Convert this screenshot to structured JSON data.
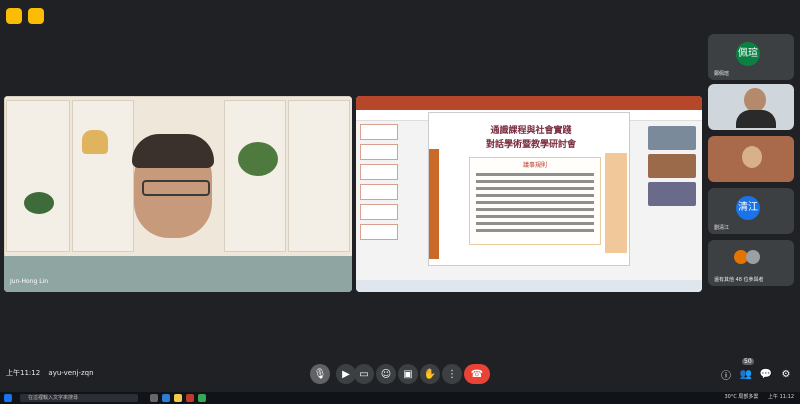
{
  "meeting": {
    "code": "ayu-venj-zqn",
    "time_label": "上午11:12"
  },
  "top_icons": [
    "activity-icon",
    "clipboard-icon"
  ],
  "main_camera": {
    "participant_name": "Jun-Hong Lin"
  },
  "presentation": {
    "app": "PowerPoint",
    "slide_title_line1": "通識課程與社會實踐",
    "slide_title_line2": "對話學術暨教學研討會",
    "rules_heading": "議事規則",
    "footer_text": ""
  },
  "side_tiles": [
    {
      "type": "avatar",
      "avatar_text": "佩瑄",
      "avatar_color": "#0b8043",
      "label": "鄭佩瑄"
    },
    {
      "type": "video",
      "label": "..."
    },
    {
      "type": "video",
      "label": "..."
    },
    {
      "type": "avatar",
      "avatar_text": "清江",
      "avatar_color": "#1a73e8",
      "label": "劉清江"
    },
    {
      "type": "group",
      "label": "還有其他 48 位參與者"
    }
  ],
  "controls": [
    {
      "name": "mic-button",
      "icon": "mic-icon"
    },
    {
      "name": "camera-button",
      "icon": "camera-icon"
    },
    {
      "name": "captions-button",
      "icon": "captions-icon"
    },
    {
      "name": "emoji-button",
      "icon": "emoji-icon"
    },
    {
      "name": "present-button",
      "icon": "present-icon"
    },
    {
      "name": "raise-hand-button",
      "icon": "hand-icon"
    },
    {
      "name": "more-button",
      "icon": "more-icon"
    },
    {
      "name": "leave-call-button",
      "icon": "phone-end-icon"
    }
  ],
  "right_controls": [
    {
      "name": "info-button",
      "icon": "info-icon"
    },
    {
      "name": "people-button",
      "icon": "people-icon",
      "badge": "50"
    },
    {
      "name": "chat-button",
      "icon": "chat-icon"
    },
    {
      "name": "activities-button",
      "icon": "activities-icon"
    }
  ],
  "taskbar": {
    "search_placeholder": "在這裡輸入文字來搜尋",
    "weather": "30°C 局部多雲",
    "clock": "上午 11:12"
  },
  "colors": {
    "background": "#202124",
    "leave_red": "#ea4335",
    "accent_yellow": "#fbbc04",
    "ppt_red": "#b7472a"
  }
}
